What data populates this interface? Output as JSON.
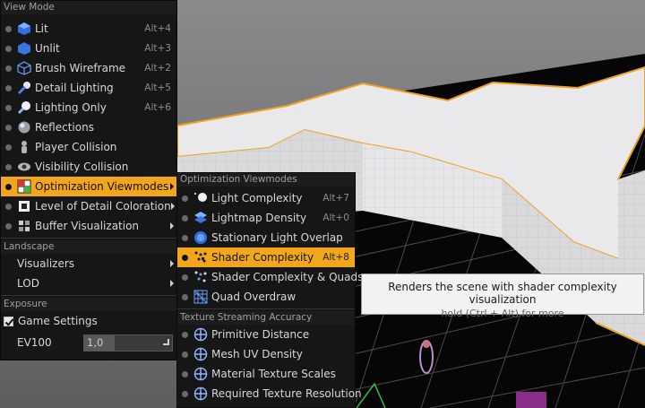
{
  "colors": {
    "highlight": "#f2a71b",
    "menu_bg": "#161616",
    "viewport_grid_bg": "#050505",
    "mesh_surface": "#e8e8ea",
    "selection_outline": "#f0a020"
  },
  "view_mode_menu": {
    "header": "View Mode",
    "items": [
      {
        "label": "Lit",
        "shortcut": "Alt+4",
        "icon": "lit-cube-icon",
        "selected": false
      },
      {
        "label": "Unlit",
        "shortcut": "Alt+3",
        "icon": "unlit-cube-icon",
        "selected": false
      },
      {
        "label": "Brush Wireframe",
        "shortcut": "Alt+2",
        "icon": "wireframe-cube-icon",
        "selected": false
      },
      {
        "label": "Detail Lighting",
        "shortcut": "Alt+5",
        "icon": "detail-lighting-icon",
        "selected": false
      },
      {
        "label": "Lighting Only",
        "shortcut": "Alt+6",
        "icon": "lighting-only-icon",
        "selected": false
      },
      {
        "label": "Reflections",
        "shortcut": "",
        "icon": "reflections-sphere-icon",
        "selected": false
      },
      {
        "label": "Player Collision",
        "shortcut": "",
        "icon": "player-collision-icon",
        "selected": false
      },
      {
        "label": "Visibility Collision",
        "shortcut": "",
        "icon": "visibility-collision-icon",
        "selected": false
      },
      {
        "label": "Optimization Viewmodes",
        "shortcut": "",
        "icon": "optimization-grid-icon",
        "selected": true,
        "submenu": true
      },
      {
        "label": "Level of Detail Coloration",
        "shortcut": "",
        "icon": "lod-coloration-icon",
        "selected": false,
        "submenu": true
      },
      {
        "label": "Buffer Visualization",
        "shortcut": "",
        "icon": "buffer-visualization-icon",
        "selected": false,
        "submenu": true
      }
    ],
    "landscape_header": "Landscape",
    "landscape_items": [
      {
        "label": "Visualizers"
      },
      {
        "label": "LOD"
      }
    ],
    "exposure_header": "Exposure",
    "game_settings_label": "Game Settings",
    "game_settings_checked": true,
    "ev100_label": "EV100",
    "ev100_value": "1,0"
  },
  "optimization_submenu": {
    "header": "Optimization Viewmodes",
    "items": [
      {
        "label": "Light Complexity",
        "shortcut": "Alt+7",
        "icon": "light-complexity-icon"
      },
      {
        "label": "Lightmap Density",
        "shortcut": "Alt+0",
        "icon": "lightmap-density-icon"
      },
      {
        "label": "Stationary Light Overlap",
        "shortcut": "",
        "icon": "stationary-light-overlap-icon"
      },
      {
        "label": "Shader Complexity",
        "shortcut": "Alt+8",
        "icon": "shader-complexity-icon",
        "highlighted": true
      },
      {
        "label": "Shader Complexity & Quads",
        "shortcut": "",
        "icon": "shader-complexity-quads-icon"
      },
      {
        "label": "Quad Overdraw",
        "shortcut": "",
        "icon": "quad-overdraw-icon"
      }
    ],
    "texture_header": "Texture Streaming Accuracy",
    "texture_items": [
      {
        "label": "Primitive Distance",
        "icon": "crosshair-circle-icon"
      },
      {
        "label": "Mesh UV Density",
        "icon": "crosshair-circle-icon"
      },
      {
        "label": "Material Texture Scales",
        "icon": "crosshair-circle-icon"
      },
      {
        "label": "Required Texture Resolution",
        "icon": "crosshair-circle-icon"
      }
    ]
  },
  "tooltip": {
    "title": "Renders the scene with shader complexity visualization",
    "hint": "hold (Ctrl + Alt) for more"
  }
}
